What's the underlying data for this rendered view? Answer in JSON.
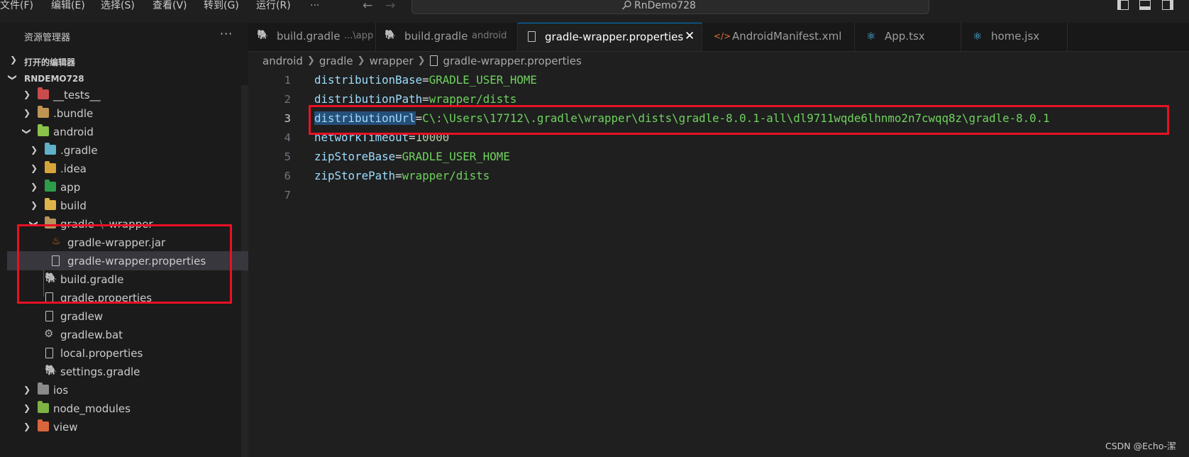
{
  "menu": [
    "文件(F)",
    "编辑(E)",
    "选择(S)",
    "查看(V)",
    "转到(G)",
    "运行(R)",
    "···"
  ],
  "nav": {
    "back_icon": "←",
    "forward_icon": "→"
  },
  "command_center": {
    "text": "RnDemo728",
    "icon": "search-icon"
  },
  "sidebar": {
    "title": "资源管理器",
    "more": "···",
    "open_editors": "打开的编辑器",
    "project": "RNDEMO728",
    "tree": [
      {
        "label": "__tests__",
        "icon": "tests-folder-icon"
      },
      {
        "label": ".bundle",
        "icon": "folder-icon"
      },
      {
        "label": "android",
        "icon": "android-folder-icon"
      },
      {
        "label": ".gradle",
        "icon": "gradle-folder-icon"
      },
      {
        "label": ".idea",
        "icon": "idea-folder-icon"
      },
      {
        "label": "app",
        "icon": "app-folder-icon"
      },
      {
        "label": "build",
        "icon": "build-folder-icon"
      },
      {
        "label": "gradle",
        "label_sep": "\\",
        "label_2": "wrapper",
        "icon": "folder-open-icon"
      },
      {
        "label": "gradle-wrapper.jar",
        "icon": "java-icon"
      },
      {
        "label": "gradle-wrapper.properties",
        "icon": "file-icon"
      },
      {
        "label": "build.gradle",
        "icon": "gradle-icon"
      },
      {
        "label": "gradle.properties",
        "icon": "file-icon"
      },
      {
        "label": "gradlew",
        "icon": "file-icon"
      },
      {
        "label": "gradlew.bat",
        "icon": "gear-icon"
      },
      {
        "label": "local.properties",
        "icon": "file-icon"
      },
      {
        "label": "settings.gradle",
        "icon": "gradle-icon"
      },
      {
        "label": "ios",
        "icon": "ios-folder-icon"
      },
      {
        "label": "node_modules",
        "icon": "node-folder-icon"
      },
      {
        "label": "view",
        "icon": "view-folder-icon"
      }
    ]
  },
  "tabs": [
    {
      "label": "build.gradle",
      "desc": "...\\app",
      "icon": "gradle-icon"
    },
    {
      "label": "build.gradle",
      "desc": "android",
      "icon": "gradle-icon"
    },
    {
      "label": "gradle-wrapper.properties",
      "desc": "",
      "icon": "file-icon",
      "close": "✕"
    },
    {
      "label": "AndroidManifest.xml",
      "desc": "",
      "icon": "xml-icon",
      "glyph": "</>"
    },
    {
      "label": "App.tsx",
      "desc": "",
      "icon": "react-icon",
      "glyph": "⚛"
    },
    {
      "label": "home.jsx",
      "desc": "",
      "icon": "react-icon",
      "glyph": "⚛"
    }
  ],
  "breadcrumb": [
    "android",
    "gradle",
    "wrapper",
    "gradle-wrapper.properties"
  ],
  "editor": {
    "line_numbers": [
      "1",
      "2",
      "3",
      "4",
      "5",
      "6",
      "7"
    ],
    "lines": [
      {
        "key": "distributionBase",
        "eq": "=",
        "value": "GRADLE_USER_HOME"
      },
      {
        "key": "distributionPath",
        "eq": "=",
        "value": "wrapper/dists"
      },
      {
        "key": "distributionUrl",
        "eq": "=",
        "value": "C\\:\\Users\\17712\\.gradle\\wrapper\\dists\\gradle-8.0.1-all\\dl9711wqde6lhnmo2n7cwqq8z\\gradle-8.0.1"
      },
      {
        "key": "networkTimeout",
        "eq": "=",
        "value": "10000"
      },
      {
        "key": "zipStoreBase",
        "eq": "=",
        "value": "GRADLE_USER_HOME"
      },
      {
        "key": "zipStorePath",
        "eq": "=",
        "value": "wrapper/dists"
      },
      {
        "key": "",
        "eq": "",
        "value": ""
      }
    ]
  },
  "watermark": "CSDN @Echo-潔",
  "colors": {
    "accent": "#0078d4",
    "annotation": "#e81123",
    "string": "#6fd35e",
    "key": "#9cdcfe"
  }
}
